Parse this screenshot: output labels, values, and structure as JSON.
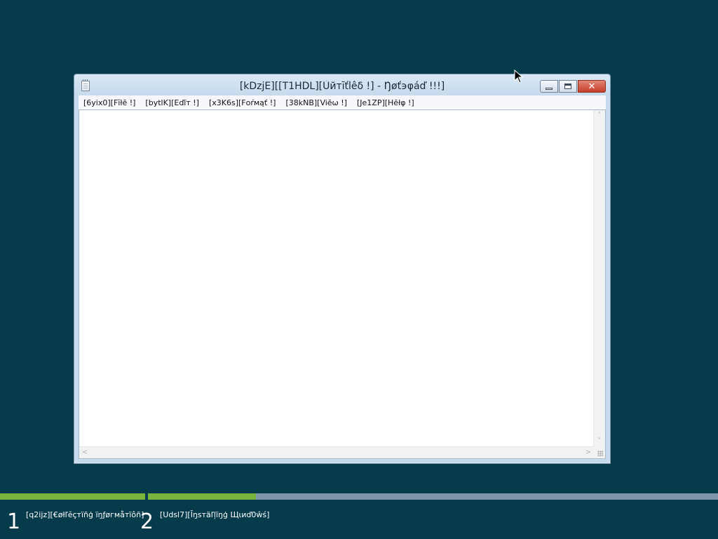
{
  "window": {
    "title": "[kDzjE][[T1HDL][Ŭйтīťĺêδ !] - Ŋøť϶φáď !!!]",
    "icon": "notepad-icon",
    "buttons": {
      "minimize": "minimize-icon",
      "maximize": "maximize-icon",
      "close": "✕"
    }
  },
  "menu": [
    {
      "label": "[6yix0][Fĭłē !]"
    },
    {
      "label": "[bytlK][Eďïт !]"
    },
    {
      "label": "[x3K6s][Fоŕмąť !]"
    },
    {
      "label": "[38kNB][Viēω !]"
    },
    {
      "label": "[Je1ZP][Hēłφ !]"
    }
  ],
  "editor": {
    "content": "",
    "scroll_up": "˄",
    "scroll_down": "˅",
    "scroll_left": "<",
    "scroll_right": ">"
  },
  "setup": {
    "steps": [
      {
        "number": "1",
        "label": "[q2ijz][€øłľĕçтïñģ ïŋƒøгмåтïôñ]",
        "progress": 1.0
      },
      {
        "number": "2",
        "label": "[Udsl7][Ĩŋѕтäľļïŋģ Щιиď0ŵś]",
        "progress": 0.19
      }
    ],
    "colors": {
      "done": "#79b53d",
      "pending": "#7f97a8"
    }
  },
  "colors": {
    "desktop": "#053b4b",
    "close_button": "#c63f2b"
  }
}
